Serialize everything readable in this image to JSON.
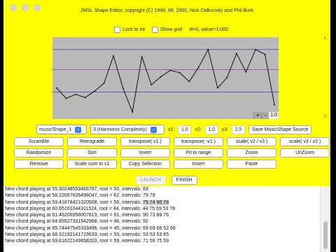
{
  "window": {
    "title": "JMSL Shape Editor, copyright (C) 1998, 99, 2000, Nick Didkovsky and Phil Burk"
  },
  "options": {
    "lock_label": "Lock to int",
    "grid_label": "Show grid",
    "status": "el=0, value=3.000"
  },
  "side_ticks": {
    "top": "1...",
    "bottom": "0..."
  },
  "chart_data": {
    "type": "line",
    "x": [
      0,
      1,
      2,
      3,
      4,
      5,
      6,
      7,
      8,
      9,
      10,
      11,
      12,
      13,
      14,
      15,
      16,
      17,
      18,
      19,
      20,
      21,
      22,
      23
    ],
    "values": [
      3.0,
      1.7,
      2.2,
      1.8,
      2.6,
      3.6,
      7.0,
      3.0,
      0.0,
      6.9,
      3.4,
      4.4,
      5.2,
      4.9,
      3.8,
      5.6,
      7.8,
      3.0,
      4.3,
      7.3,
      5.0,
      7.8,
      7.2,
      0.9
    ],
    "ylim": [
      0,
      9
    ],
    "guide_lines": [
      2.5,
      5.3,
      7.8
    ],
    "colors": {
      "line": "#000000",
      "background": "#b9b9b9",
      "guide_blue": "#3a3acc",
      "guide_purple": "#a030c0"
    }
  },
  "zoom": {
    "plus": "+",
    "minus": "-",
    "value": "1.0"
  },
  "controls": {
    "shape_select": "musicShape_1",
    "dim_select": "3 (Harmonic Complexity)",
    "v1_label": "v1:",
    "v1": "1.0",
    "v2_label": "v2:",
    "v2": "1.0",
    "v3_label": "v3:",
    "v3": "2.0",
    "save_label": "Save MusicShape Source"
  },
  "buttons": [
    [
      "Scramble",
      "Retrograde",
      "transpose( v1 )",
      "transpose( -v1 )",
      "scale( v2 / v3 )",
      "scale( v3 / v2 )"
    ],
    [
      "Randomize",
      "Sort",
      "Invert",
      "Fit to range",
      "Zoom",
      "UnZoom"
    ],
    [
      "Remove",
      "Scale sum to v1",
      "Copy Selection",
      "Insert",
      "Paste",
      ""
    ]
  ],
  "launch": {
    "launch": "LAUNCH",
    "finish": "FINISH"
  },
  "log": [
    {
      "text": "New chord playing at 55.30248553466797, root = 50, intervals: 63"
    },
    {
      "text": "New chord playing at 58.22057635498047, root = 62, intervals: 79 78"
    },
    {
      "prefix": "New chord playing at 59.41878421020508, root = 59, intervals: ",
      "hl": "75 74 90 78"
    },
    {
      "text": "New chord playing at 60.65161044311524, root = 44, intervals: 44 75 59 53 78"
    },
    {
      "text": "New chord playing at 61.46206958007813, root = 61, intervals: 90 73 89 76"
    },
    {
      "text": "New chord playing at 64.85527331542968, root = 48, intervals: 52"
    },
    {
      "text": "New chord playing at 65.74447545333496, root = 45, intervals: 69 69 66 52 66"
    },
    {
      "text": "New chord playing at 68.32192141723633, root = 53, intervals: 53 53 53 65"
    },
    {
      "text": "New chord playing at 69.61622149658203, root = 59, intervals: 71 59 75 59"
    }
  ]
}
